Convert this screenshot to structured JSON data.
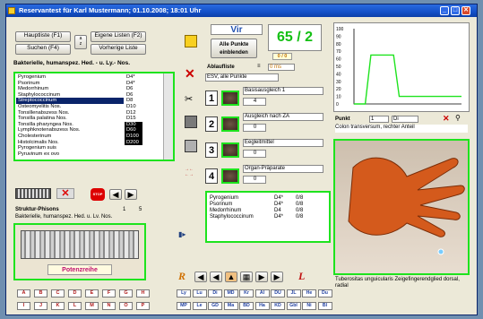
{
  "window": {
    "title": "Reservantest für Karl Mustermann; 01.10.2008; 18:01 Uhr",
    "min": "_",
    "max": "□",
    "close": "✕"
  },
  "nav": {
    "btn_main": "Hauptliste (F1)",
    "btn_own": "Eigene Listen (F2)",
    "btn_search": "Suchen (F4)",
    "btn_prev": "Vorherige Liste",
    "sort": "a\nz"
  },
  "current_title": "Bakterielle, humanspez. Hed. - u. Ly.- Nos.",
  "list": {
    "items": [
      "Pyrogenium",
      "Psorinum",
      "Medorrhinum",
      "Staphylococcinum",
      "Streptococcinum",
      "Osteomyelitis Nos.",
      "Tonsillenabszess Nos.",
      "Tonsilla palatina Nos.",
      "Tonsilla pharyngea Nos.",
      "Lymphknotenabszess Nos.",
      "Cholesterinum",
      "Histolcimalis Nos.",
      "Pyrogenium suis",
      "Pyruvinum ex ovo"
    ],
    "selected_index": 4,
    "potencies": [
      "D4*",
      "D4*",
      "D6",
      "D6",
      "D8",
      "D10",
      "D12",
      "D15",
      "D30",
      "D60",
      "D100",
      "D200"
    ],
    "potency_selected": [
      8,
      9,
      10,
      11
    ]
  },
  "vir": {
    "label": "Vir",
    "score": "65 / 2",
    "sub_score": "0 / 0",
    "all_points_btn": "Alle Punkte\neinblenden",
    "ablauf_label": "Ablaufliste",
    "ablauf_field": "0 ms",
    "esv_select": "ESV, alle Punkte"
  },
  "slots": [
    {
      "num": "1",
      "name": "Basisausgleich 1",
      "val": "4"
    },
    {
      "num": "2",
      "name": "Ausgleich nach ZA",
      "val": "0"
    },
    {
      "num": "3",
      "name": "Eegleitmittel",
      "val": "0"
    },
    {
      "num": "4",
      "name": "Organ-Präparate",
      "val": "0"
    }
  ],
  "result_list": [
    {
      "name": "Pyrogenium",
      "pot": "D4*",
      "val": "0/8"
    },
    {
      "name": "Psorinum",
      "pot": "D4*",
      "val": "0/8"
    },
    {
      "name": "Medorrhinum",
      "pot": "D4",
      "val": "0/8"
    },
    {
      "name": "Staphylococcinum",
      "pot": "D4*",
      "val": "0/8"
    }
  ],
  "chart_data": {
    "type": "line",
    "y_ticks": [
      "100",
      "90",
      "80",
      "70",
      "60",
      "50",
      "40",
      "30",
      "20",
      "10",
      "0"
    ],
    "ylim": [
      0,
      100
    ],
    "points": [
      0,
      0,
      0,
      65,
      65,
      65,
      65,
      65,
      10,
      10,
      10,
      10,
      10,
      10,
      10,
      10,
      10,
      10,
      10,
      10
    ],
    "color": "#1ee31e"
  },
  "point": {
    "label": "Punkt",
    "number": "1",
    "code": "Di",
    "description": "Colon transversum, rechter Anteil"
  },
  "photo_caption": "Tuberositas unguicularis Zeigefingerendglied dorsal, radial",
  "struktur": {
    "label": "Struktur-Phisons",
    "count": "1",
    "count2": "5",
    "text": "Bakterielle, humanspez. Hed. u. Lv. Nos."
  },
  "ampoule_label": "Potenzreihe",
  "alphabet": [
    "A",
    "B",
    "C",
    "D",
    "E",
    "F",
    "G",
    "H",
    "I",
    "J",
    "K",
    "L",
    "M",
    "N",
    "O",
    "P"
  ],
  "groups_top": [
    "Ly",
    "Lu",
    "Di",
    "MD",
    "Kr",
    "Al",
    "DU",
    "JL",
    "He",
    "Du"
  ],
  "groups_bottom": [
    "MP",
    "Le",
    "GD",
    "Ma",
    "BD",
    "Ha",
    "KD",
    "Gbl",
    "Ni",
    "Bl"
  ],
  "nav_r": "R",
  "nav_l": "L"
}
